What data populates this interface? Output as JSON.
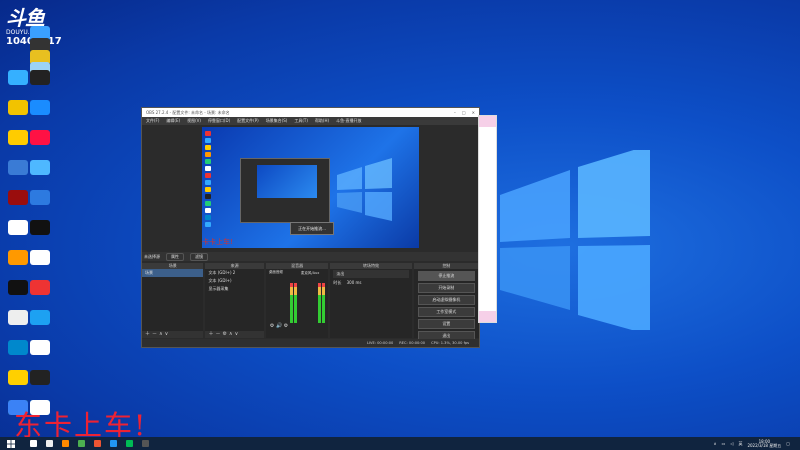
{
  "watermark": {
    "logo": "斗鱼",
    "site": "DOUYU.COM",
    "room": "10407517"
  },
  "desktop_icons": [
    {
      "color": "#e33"
    },
    {
      "color": "#ffd02e"
    },
    {
      "color": "#3aa0ff"
    },
    {
      "color": "#333"
    },
    {
      "color": "#e8c020"
    },
    {
      "color": "#9cd3f7"
    },
    {
      "color": "#35b0ff"
    },
    {
      "color": "#222"
    },
    {
      "color": "#f2c300"
    },
    {
      "color": "#1a8cff"
    },
    {
      "color": "#ffcc00"
    },
    {
      "color": "#f14"
    },
    {
      "color": "#3a7bd5"
    },
    {
      "color": "#4eb8ff"
    },
    {
      "color": "#9a0d0d"
    },
    {
      "color": "#2d7ae0"
    },
    {
      "color": "#fff"
    },
    {
      "color": "#111"
    },
    {
      "color": "#f90"
    },
    {
      "color": "#fff"
    },
    {
      "color": "#111"
    },
    {
      "color": "#e33"
    },
    {
      "color": "#eee"
    },
    {
      "color": "#1da1f2"
    },
    {
      "color": "#08c"
    },
    {
      "color": "#fff"
    },
    {
      "color": "#ffd000"
    },
    {
      "color": "#222"
    },
    {
      "color": "#2f7"
    },
    {
      "color": "#16a3e8"
    },
    {
      "color": "#1976d2"
    },
    {
      "color": "#0078d4"
    },
    {
      "color": "#24c35a"
    },
    {
      "color": "#0c7fd8"
    },
    {
      "color": "#111"
    },
    {
      "color": "#fff"
    },
    {
      "color": "#3b82f6"
    }
  ],
  "obs": {
    "title": "OBS 27.2.4 - 配置文件: 未命名 - 场景: 未命名",
    "menu": [
      "文件(F)",
      "编辑(E)",
      "视图(V)",
      "停靠窗口(D)",
      "配置文件(P)",
      "场景集合(S)",
      "工具(T)",
      "帮助(H)",
      "斗鱼-直播开放"
    ],
    "preview_caption": "卡卡上车!",
    "inner_dialog": "正在开始推流...",
    "scene_bar": {
      "label": "未选择源",
      "tabs": [
        "属性",
        "滤镜"
      ]
    },
    "docks": {
      "scenes": {
        "title": "场景",
        "items": [
          "场景"
        ]
      },
      "sources": {
        "title": "来源",
        "items": [
          "文本 (GDI+) 2",
          "文本 (GDI+)",
          "显示器采集"
        ]
      },
      "mixer": {
        "title": "混音器",
        "channels": [
          "桌面音频",
          "麦克风/Aux"
        ]
      },
      "transitions": {
        "title": "转场特效",
        "type": "淡出",
        "duration_label": "时长",
        "duration": "300 ms"
      },
      "controls": {
        "title": "控制",
        "buttons": [
          "停止推流",
          "开始录制",
          "启动虚拟摄像机",
          "工作室模式",
          "设置",
          "退出"
        ]
      }
    },
    "status": [
      "LIVE: 00:00:00",
      "REC: 00:00:00",
      "CPU: 1.3%, 30.00 fps"
    ]
  },
  "caption": "东卡上车!",
  "taskbar": {
    "icons": [
      "#fff",
      "#eee",
      "#ff8a00",
      "#4caf50",
      "#e53",
      "#2196f3",
      "#0b5",
      "#555"
    ],
    "time": "18:00",
    "date": "2022/3/18 星期五"
  }
}
